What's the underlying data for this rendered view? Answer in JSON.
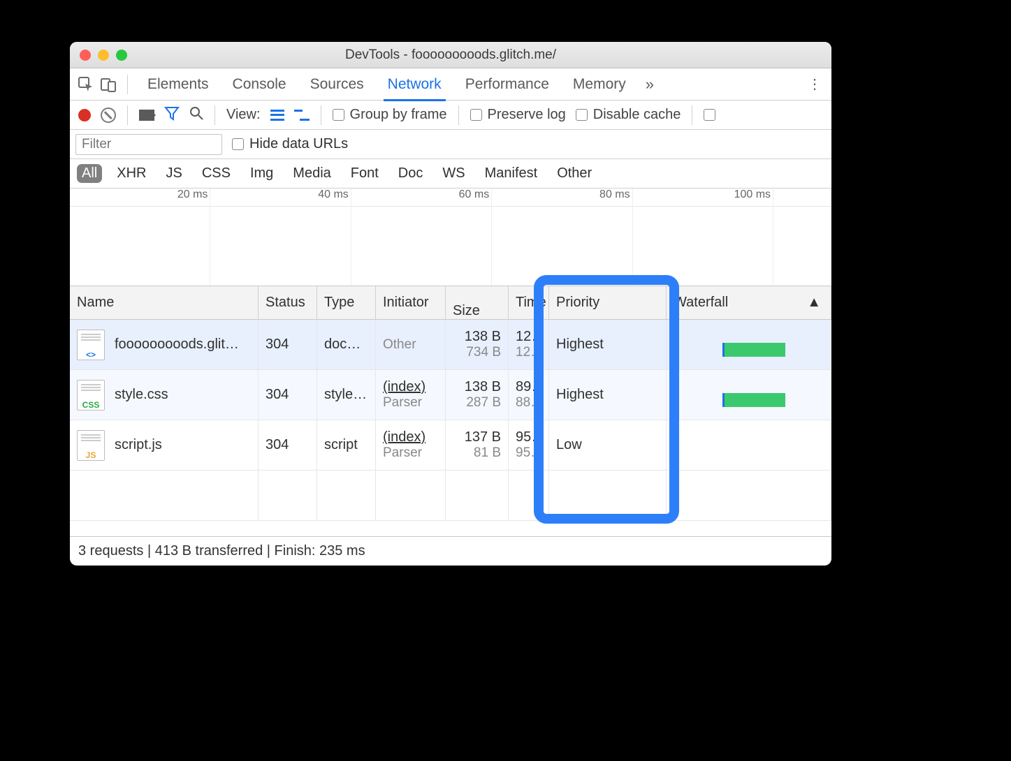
{
  "window": {
    "title": "DevTools - fooooooooods.glitch.me/"
  },
  "tabs": {
    "items": [
      "Elements",
      "Console",
      "Sources",
      "Network",
      "Performance",
      "Memory"
    ],
    "active_index": 3,
    "overflow": "»"
  },
  "toolbar": {
    "view_label": "View:",
    "group_by_frame": "Group by frame",
    "preserve_log": "Preserve log",
    "disable_cache": "Disable cache"
  },
  "filter": {
    "placeholder": "Filter",
    "hide_data_urls": "Hide data URLs"
  },
  "types": [
    "All",
    "XHR",
    "JS",
    "CSS",
    "Img",
    "Media",
    "Font",
    "Doc",
    "WS",
    "Manifest",
    "Other"
  ],
  "types_active_index": 0,
  "timeline": {
    "ticks": [
      "20 ms",
      "40 ms",
      "60 ms",
      "80 ms",
      "100 ms"
    ]
  },
  "columns": [
    "Name",
    "Status",
    "Type",
    "Initiator",
    "Size",
    "Time",
    "Priority",
    "Waterfall"
  ],
  "sort_indicator": "▲",
  "rows": [
    {
      "icon": "html",
      "icon_label": "<>",
      "name": "fooooooooods.glit…",
      "status": "304",
      "type": "doc…",
      "initiator_top": "Other",
      "initiator_sub": "",
      "size_top": "138 B",
      "size_sub": "734 B",
      "time_top": "12…",
      "time_sub": "12…",
      "priority": "Highest",
      "has_bar": true
    },
    {
      "icon": "css",
      "icon_label": "CSS",
      "name": "style.css",
      "status": "304",
      "type": "style…",
      "initiator_top": "(index)",
      "initiator_sub": "Parser",
      "size_top": "138 B",
      "size_sub": "287 B",
      "time_top": "89…",
      "time_sub": "88…",
      "priority": "Highest",
      "has_bar": true
    },
    {
      "icon": "js",
      "icon_label": "JS",
      "name": "script.js",
      "status": "304",
      "type": "script",
      "initiator_top": "(index)",
      "initiator_sub": "Parser",
      "size_top": "137 B",
      "size_sub": "81 B",
      "time_top": "95…",
      "time_sub": "95…",
      "priority": "Low",
      "has_bar": false
    }
  ],
  "status_bar": "3 requests | 413 B transferred | Finish: 235 ms"
}
